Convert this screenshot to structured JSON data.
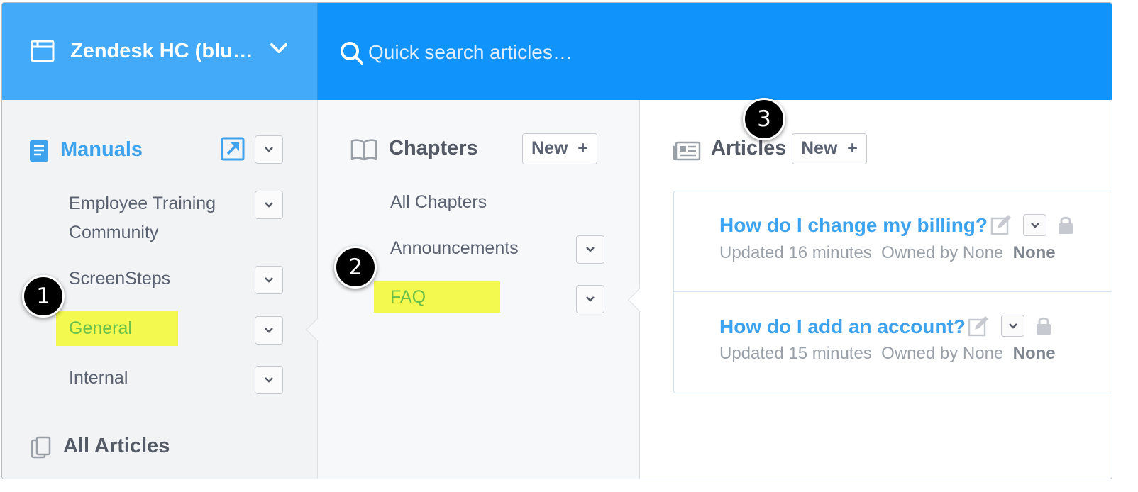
{
  "header": {
    "site_name": "Zendesk HC (blu…",
    "search_placeholder": "Quick search articles…"
  },
  "manuals": {
    "title": "Manuals",
    "items": [
      {
        "label": "Employee Training Community"
      },
      {
        "label": "ScreenSteps"
      },
      {
        "label": "General",
        "selected": true
      },
      {
        "label": "Internal"
      }
    ],
    "all_articles": "All Articles"
  },
  "chapters": {
    "title": "Chapters",
    "new_button": "New",
    "items": [
      {
        "label": "All Chapters"
      },
      {
        "label": "Announcements"
      },
      {
        "label": "FAQ",
        "selected": true
      }
    ]
  },
  "articles": {
    "title": "Articles",
    "new_button": "New",
    "items": [
      {
        "title": "How do I change my billing?",
        "updated": "Updated 16 minutes",
        "owned": "Owned by None",
        "status": "None"
      },
      {
        "title": "How do I add an account?",
        "updated": "Updated 15 minutes",
        "owned": "Owned by None",
        "status": "None"
      }
    ]
  },
  "callouts": [
    "1",
    "2",
    "3"
  ],
  "colors": {
    "header_bg": "#1094fb",
    "site_switch_bg": "#42aaf9",
    "link_blue": "#3ea3ef",
    "highlight_yellow": "#f3f94e",
    "selected_green": "#6cc04a"
  }
}
